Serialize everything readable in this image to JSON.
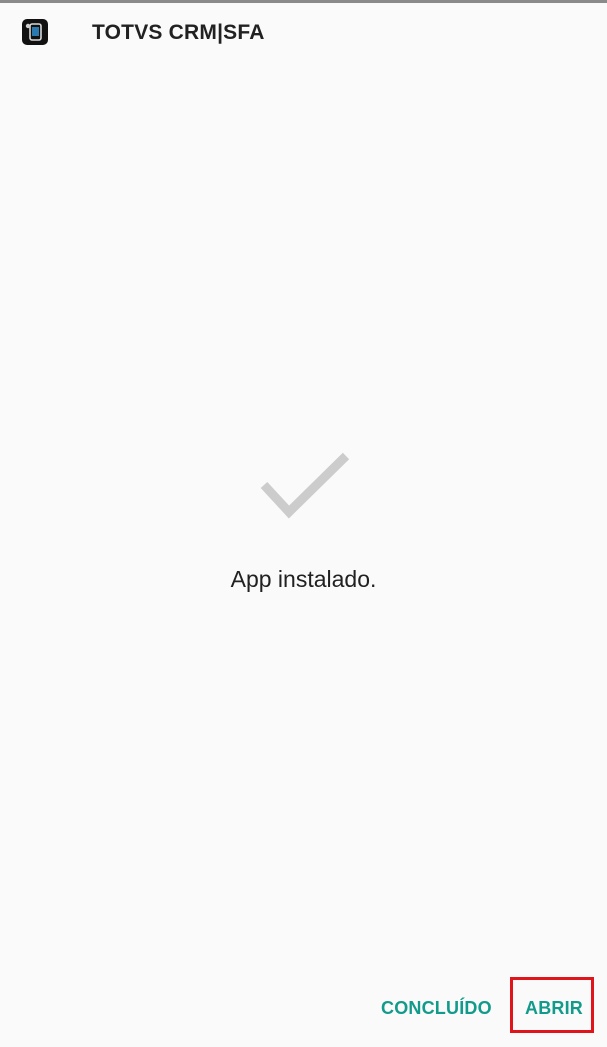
{
  "header": {
    "app_icon": "totvs-app-icon",
    "app_title": "TOTVS CRM|SFA"
  },
  "status": {
    "icon": "checkmark-icon",
    "text": "App instalado."
  },
  "actions": {
    "done_label": "CONCLUÍDO",
    "open_label": "ABRIR",
    "accent_color": "#129b8b",
    "highlight_color": "#e0141b"
  }
}
